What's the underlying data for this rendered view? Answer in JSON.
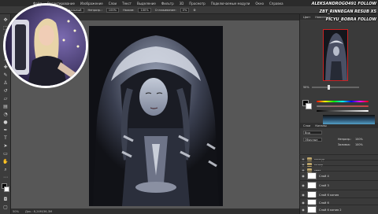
{
  "app": {
    "menu": [
      "Файл",
      "Редактирование",
      "Изображение",
      "Слои",
      "Текст",
      "Выделение",
      "Фильтр",
      "3D",
      "Просмотр",
      "Подключаемые модули",
      "Окно",
      "Справка"
    ],
    "options": {
      "brush_size": "10",
      "mode_label": "Режим:",
      "mode_value": "Нормальный",
      "opacity_label": "Непрозр.:",
      "opacity_value": "100%",
      "flow_label": "Нажим:",
      "flow_value": "100%",
      "smooth_label": "Сглаживание:",
      "smooth_value": "0%"
    }
  },
  "status": {
    "zoom": "50%",
    "doc": "Док.: 8,24M/36,3M"
  },
  "panel": {
    "top_tabs": [
      "Цвет",
      "Навигатор"
    ],
    "nav_zoom": "50%",
    "layers_tabs": [
      "Слои",
      "Каналы"
    ],
    "kind_label": "Вид",
    "blend_label": "Обычные",
    "opacity_label": "Непрозр.:",
    "opacity_value": "100%",
    "fill_label": "Заливка:",
    "fill_value": "100%",
    "layers": [
      {
        "name": "контур",
        "type": "folder"
      },
      {
        "name": "колор",
        "type": "folder"
      },
      {
        "name": "свет",
        "type": "folder"
      },
      {
        "name": "Слой 4",
        "type": "layer"
      },
      {
        "name": "Слой 3",
        "type": "layer"
      },
      {
        "name": "Слой 6 копия",
        "type": "layer"
      },
      {
        "name": "Слой 6",
        "type": "layer"
      },
      {
        "name": "Слой 6 копия 2",
        "type": "layer"
      }
    ]
  },
  "overlay": {
    "follow_lines": [
      "ALEKSANDROGO491 FOLLOW",
      "ZBT_RINNEGAN RESUB X5",
      "PICYU_BOBRA FOLLOW"
    ]
  },
  "colors": {
    "accent_red": "#cc2222",
    "webcam_ring": "#ffffff",
    "canvas_bg": "#101116"
  }
}
